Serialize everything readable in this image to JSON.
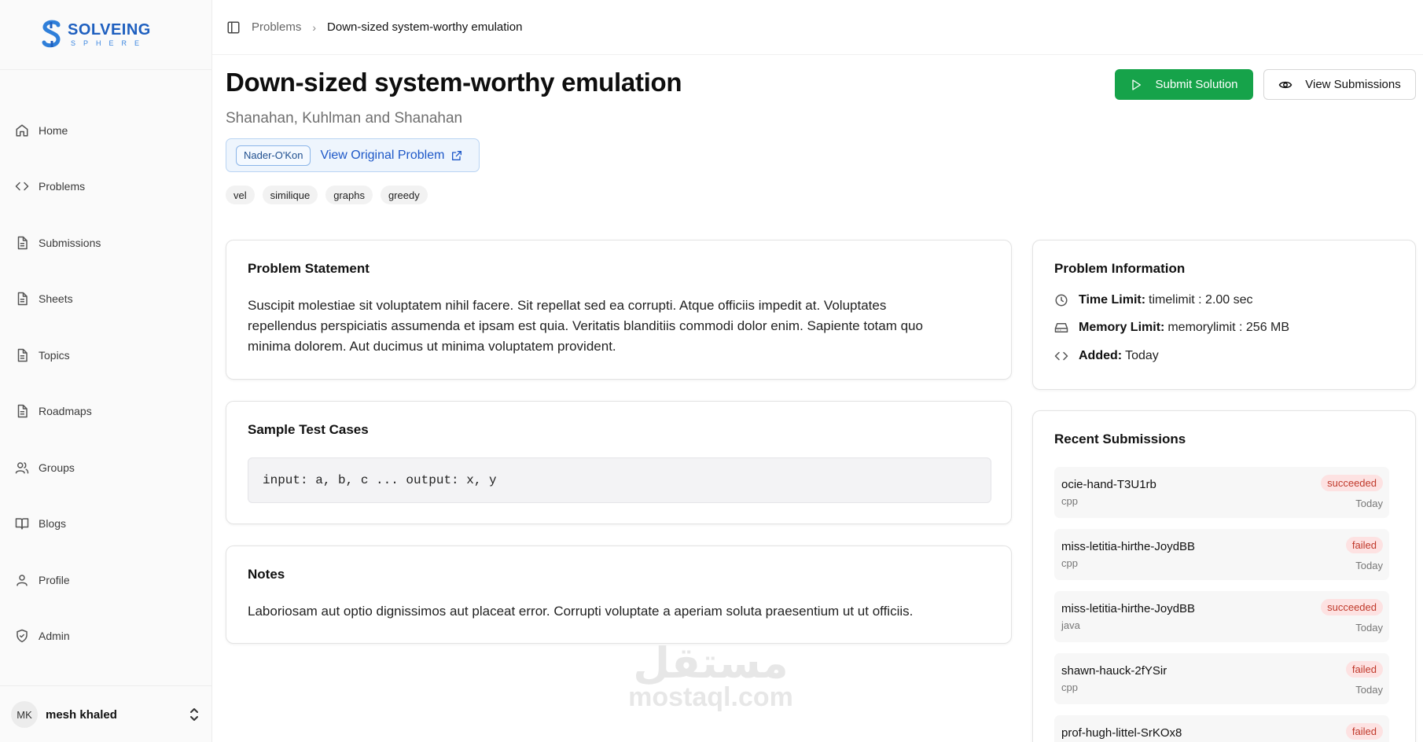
{
  "brand": {
    "name": "SOLVEING",
    "sub": "SPHERE"
  },
  "sidebar": {
    "items": [
      {
        "label": "Home",
        "icon": "home-icon"
      },
      {
        "label": "Problems",
        "icon": "code-icon"
      },
      {
        "label": "Submissions",
        "icon": "file-icon"
      },
      {
        "label": "Sheets",
        "icon": "file-icon"
      },
      {
        "label": "Topics",
        "icon": "file-icon"
      },
      {
        "label": "Roadmaps",
        "icon": "file-icon"
      },
      {
        "label": "Groups",
        "icon": "users-icon"
      },
      {
        "label": "Blogs",
        "icon": "book-icon"
      },
      {
        "label": "Profile",
        "icon": "user-icon"
      },
      {
        "label": "Admin",
        "icon": "shield-icon"
      }
    ],
    "user": {
      "initials": "MK",
      "name": "mesh khaled"
    }
  },
  "breadcrumb": {
    "parent": "Problems",
    "current": "Down-sized system-worthy emulation"
  },
  "problem": {
    "title": "Down-sized system-worthy emulation",
    "authors": "Shanahan, Kuhlman and Shanahan",
    "source_chip": "Nader-O'Kon",
    "source_link": "View Original Problem",
    "tags": [
      "vel",
      "similique",
      "graphs",
      "greedy"
    ]
  },
  "actions": {
    "submit": "Submit Solution",
    "view": "View Submissions"
  },
  "statement": {
    "title": "Problem Statement",
    "lines": [
      "Suscipit molestiae sit voluptatem nihil facere. Sit repellat sed ea corrupti. Atque officiis impedit at. Voluptates",
      "repellendus perspiciatis assumenda et ipsam est quia. Veritatis blanditiis commodi dolor enim. Sapiente totam quo",
      "minima dolorem. Aut ducimus ut minima voluptatem provident."
    ]
  },
  "samples": {
    "title": "Sample Test Cases",
    "code": "input: a, b, c ... output: x, y"
  },
  "notes": {
    "title": "Notes",
    "text": "Laboriosam aut optio dignissimos aut placeat error. Corrupti voluptate a aperiam soluta praesentium ut ut officiis."
  },
  "info": {
    "title": "Problem Information",
    "time_label": "Time Limit:",
    "time_value": "timelimit : 2.00 sec",
    "memory_label": "Memory Limit:",
    "memory_value": "memorylimit : 256 MB",
    "added_label": "Added:",
    "added_value": "Today"
  },
  "recent": {
    "title": "Recent Submissions",
    "items": [
      {
        "name": "ocie-hand-T3U1rb",
        "lang": "cpp",
        "status": "succeeded",
        "time": "Today"
      },
      {
        "name": "miss-letitia-hirthe-JoydBB",
        "lang": "cpp",
        "status": "failed",
        "time": "Today"
      },
      {
        "name": "miss-letitia-hirthe-JoydBB",
        "lang": "java",
        "status": "succeeded",
        "time": "Today"
      },
      {
        "name": "shawn-hauck-2fYSir",
        "lang": "cpp",
        "status": "failed",
        "time": "Today"
      },
      {
        "name": "prof-hugh-littel-SrKOx8",
        "lang": "",
        "status": "failed",
        "time": ""
      }
    ]
  },
  "watermark": {
    "arabic": "مستقل",
    "latin": "mostaql.com"
  },
  "colors": {
    "primary_green": "#16a34a",
    "brand_blue": "#1e5fbf",
    "link_blue": "#1e58c8",
    "status_red": "#c0392b"
  }
}
